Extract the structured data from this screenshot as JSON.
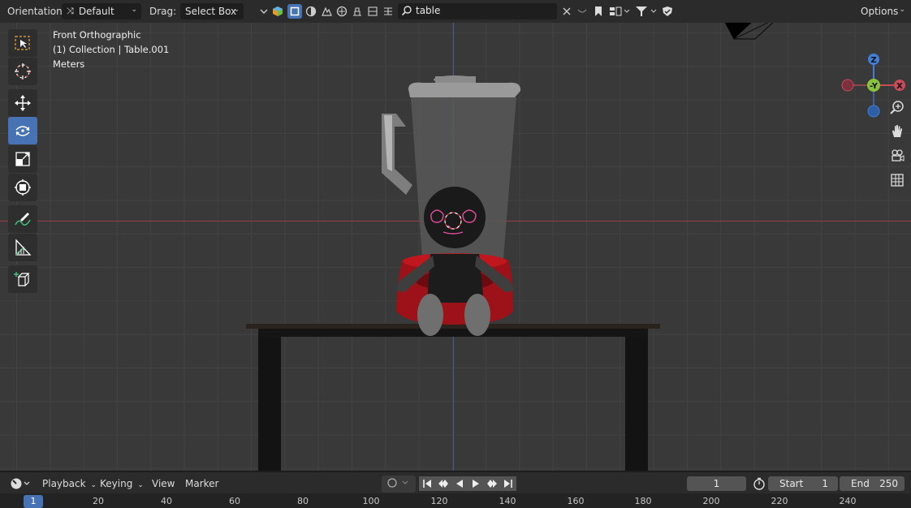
{
  "header": {
    "orientation_label": "Orientation:",
    "orientation_value": "Default",
    "drag_label": "Drag:",
    "drag_value": "Select Box",
    "search_value": "table",
    "options_label": "Options"
  },
  "viewport": {
    "view_name": "Front Orthographic",
    "collection": "(1) Collection | Table.001",
    "units": "Meters",
    "gizmo": {
      "z": "Z",
      "y": "-Y",
      "x": "X"
    }
  },
  "toolbar": {
    "tools": [
      "select-box",
      "cursor",
      "move",
      "rotate",
      "scale",
      "transform",
      "annotate",
      "measure",
      "add-cube"
    ],
    "active_tool": "rotate"
  },
  "timeline": {
    "playback": "Playback",
    "keying": "Keying",
    "view": "View",
    "marker": "Marker",
    "current_frame": "1",
    "start_label": "Start",
    "start_value": "1",
    "end_label": "End",
    "end_value": "250",
    "ruler_current": "1",
    "ticks": [
      "20",
      "40",
      "60",
      "80",
      "100",
      "120",
      "140",
      "160",
      "180",
      "200",
      "220",
      "240"
    ]
  },
  "colors": {
    "accent": "#4772b3",
    "axis_x": "#c84b5a",
    "axis_y": "#8ac43c",
    "axis_z": "#3f7fd6",
    "blender_base_red": "#a6141a"
  }
}
